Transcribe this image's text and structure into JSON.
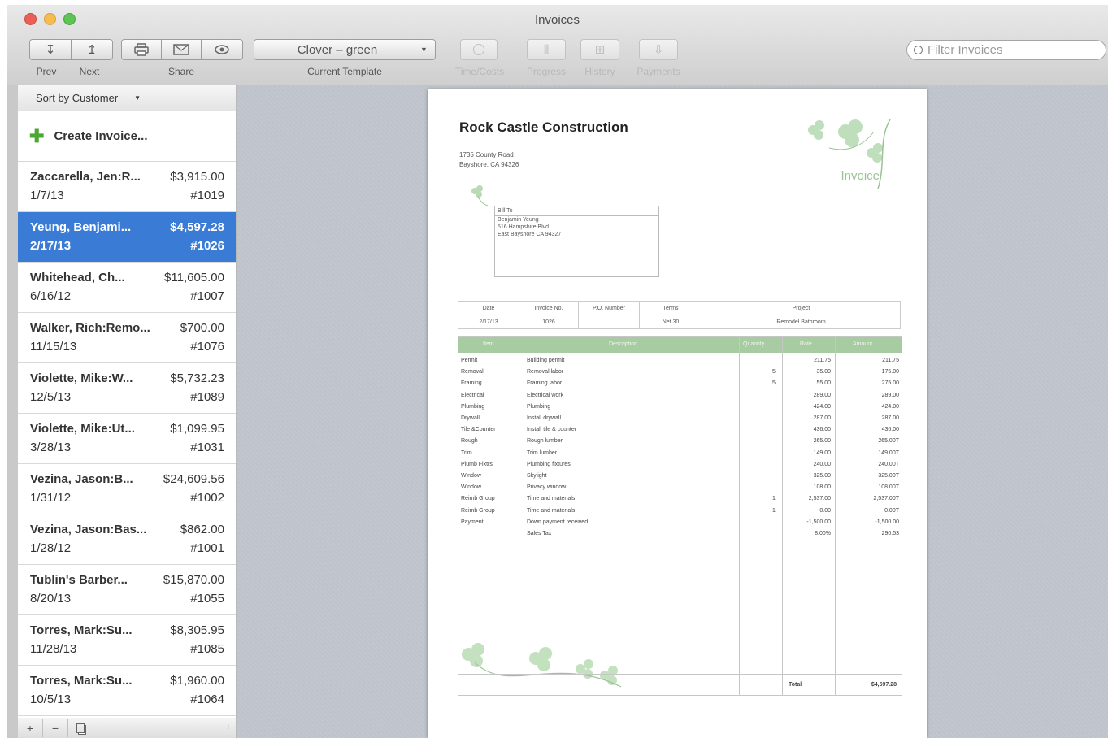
{
  "window": {
    "title": "Invoices"
  },
  "colors": {
    "close": "#ec5f56",
    "minimize": "#f5bd4f",
    "zoom": "#5fc453",
    "selection": "#3a7bd5",
    "invoice_accent": "#a8cca1"
  },
  "toolbar": {
    "prev_label": "Prev",
    "next_label": "Next",
    "share_label": "Share",
    "template_label": "Current Template",
    "template_value": "Clover – green",
    "time_costs_label": "Time/Costs",
    "progress_label": "Progress",
    "history_label": "History",
    "payments_label": "Payments",
    "search_placeholder": "Filter Invoices"
  },
  "sidebar": {
    "sort_label": "Sort by Customer",
    "create_label": "Create Invoice...",
    "invoices": [
      {
        "name": "Zaccarella, Jen:R...",
        "amount": "$3,915.00",
        "date": "1/7/13",
        "number": "#1019"
      },
      {
        "name": "Yeung, Benjami...",
        "amount": "$4,597.28",
        "date": "2/17/13",
        "number": "#1026"
      },
      {
        "name": "Whitehead, Ch...",
        "amount": "$11,605.00",
        "date": "6/16/12",
        "number": "#1007"
      },
      {
        "name": "Walker, Rich:Remo...",
        "amount": "$700.00",
        "date": "11/15/13",
        "number": "#1076"
      },
      {
        "name": "Violette, Mike:W...",
        "amount": "$5,732.23",
        "date": "12/5/13",
        "number": "#1089"
      },
      {
        "name": "Violette, Mike:Ut...",
        "amount": "$1,099.95",
        "date": "3/28/13",
        "number": "#1031"
      },
      {
        "name": "Vezina, Jason:B...",
        "amount": "$24,609.56",
        "date": "1/31/12",
        "number": "#1002"
      },
      {
        "name": "Vezina, Jason:Bas...",
        "amount": "$862.00",
        "date": "1/28/12",
        "number": "#1001"
      },
      {
        "name": "Tublin's Barber...",
        "amount": "$15,870.00",
        "date": "8/20/13",
        "number": "#1055"
      },
      {
        "name": "Torres, Mark:Su...",
        "amount": "$8,305.95",
        "date": "11/28/13",
        "number": "#1085"
      },
      {
        "name": "Torres, Mark:Su...",
        "amount": "$1,960.00",
        "date": "10/5/13",
        "number": "#1064"
      }
    ],
    "footer": {
      "add": "+",
      "remove": "−"
    }
  },
  "invoice": {
    "company": "Rock Castle Construction",
    "address1": "1735 County Road",
    "address2": "Bayshore, CA 94326",
    "doc_label": "Invoice",
    "bill_to_header": "Bill To",
    "bill_to": [
      "Benjamin Yeung",
      "516 Hampshire Blvd",
      "East Bayshore CA 94327"
    ],
    "meta_headers": [
      "Date",
      "Invoice No.",
      "P.O. Number",
      "Terms",
      "Project"
    ],
    "meta_values": [
      "2/17/13",
      "1026",
      "",
      "Net 30",
      "Remodel Bathroom"
    ],
    "item_headers": [
      "Item",
      "Description",
      "Quantity",
      "Rate",
      "Amount"
    ],
    "items": [
      {
        "item": "Permit",
        "desc": "Building permit",
        "qty": "",
        "rate": "211.75",
        "amount": "211.75"
      },
      {
        "item": "Removal",
        "desc": "Removal labor",
        "qty": "5",
        "rate": "35.00",
        "amount": "175.00"
      },
      {
        "item": "Framing",
        "desc": "Framing labor",
        "qty": "5",
        "rate": "55.00",
        "amount": "275.00"
      },
      {
        "item": "Electrical",
        "desc": "Electrical work",
        "qty": "",
        "rate": "289.00",
        "amount": "289.00"
      },
      {
        "item": "Plumbing",
        "desc": "Plumbing",
        "qty": "",
        "rate": "424.00",
        "amount": "424.00"
      },
      {
        "item": "Drywall",
        "desc": "Install drywall",
        "qty": "",
        "rate": "287.00",
        "amount": "287.00"
      },
      {
        "item": "Tile &Counter",
        "desc": "Install tile & counter",
        "qty": "",
        "rate": "436.00",
        "amount": "436.00"
      },
      {
        "item": "Rough",
        "desc": "Rough lumber",
        "qty": "",
        "rate": "265.00",
        "amount": "265.00T"
      },
      {
        "item": "Trim",
        "desc": "Trim lumber",
        "qty": "",
        "rate": "149.00",
        "amount": "149.00T"
      },
      {
        "item": "Plumb Fixtrs",
        "desc": "Plumbing fixtures",
        "qty": "",
        "rate": "240.00",
        "amount": "240.00T"
      },
      {
        "item": "Window",
        "desc": "Skylight",
        "qty": "",
        "rate": "325.00",
        "amount": "325.00T"
      },
      {
        "item": "Window",
        "desc": "Privacy window",
        "qty": "",
        "rate": "108.00",
        "amount": "108.00T"
      },
      {
        "item": "Reimb Group",
        "desc": "Time and materials",
        "qty": "1",
        "rate": "2,537.00",
        "amount": "2,537.00T"
      },
      {
        "item": "Reimb Group",
        "desc": "Time and materials",
        "qty": "1",
        "rate": "0.00",
        "amount": "0.00T"
      },
      {
        "item": "Payment",
        "desc": "Down payment received",
        "qty": "",
        "rate": "-1,500.00",
        "amount": "-1,500.00"
      },
      {
        "item": "",
        "desc": "Sales Tax",
        "qty": "",
        "rate": "8.00%",
        "amount": "290.53"
      }
    ],
    "total_label": "Total",
    "total_value": "$4,597.28"
  }
}
